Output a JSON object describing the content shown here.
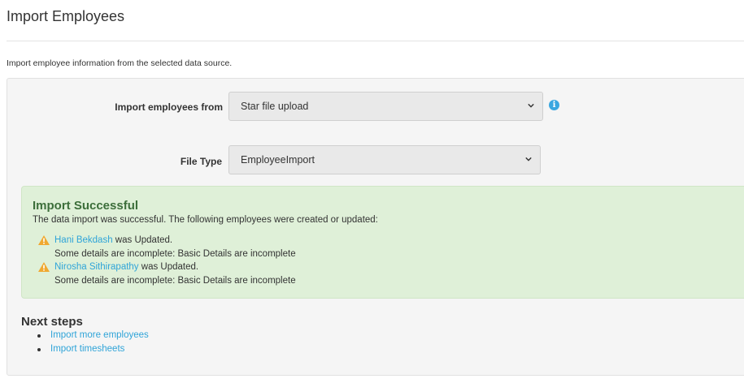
{
  "header": {
    "title": "Import Employees",
    "description": "Import employee information from the selected data source."
  },
  "form": {
    "import_from_label": "Import employees from",
    "import_from_value": "Star file upload",
    "file_type_label": "File Type",
    "file_type_value": "EmployeeImport"
  },
  "alert": {
    "title": "Import Successful",
    "message": "The data import was successful. The following employees were created or updated:",
    "entries": [
      {
        "name": "Hani Bekdash",
        "status": " was Updated.",
        "detail": "Some details are incomplete: Basic Details are incomplete"
      },
      {
        "name": "Nirosha Sithirapathy",
        "status": " was Updated.",
        "detail": "Some details are incomplete: Basic Details are incomplete"
      }
    ]
  },
  "next_steps": {
    "title": "Next steps",
    "links": [
      "Import more employees",
      "Import timesheets"
    ]
  },
  "colors": {
    "link": "#2fa4d8",
    "success_bg": "#dff0d8",
    "success_title": "#3c6e3a",
    "warning": "#f0a830",
    "info": "#3aa7e0"
  },
  "icons": {
    "info": "info-icon",
    "warning": "warning-icon",
    "dropdown": "chevron-down-icon"
  }
}
